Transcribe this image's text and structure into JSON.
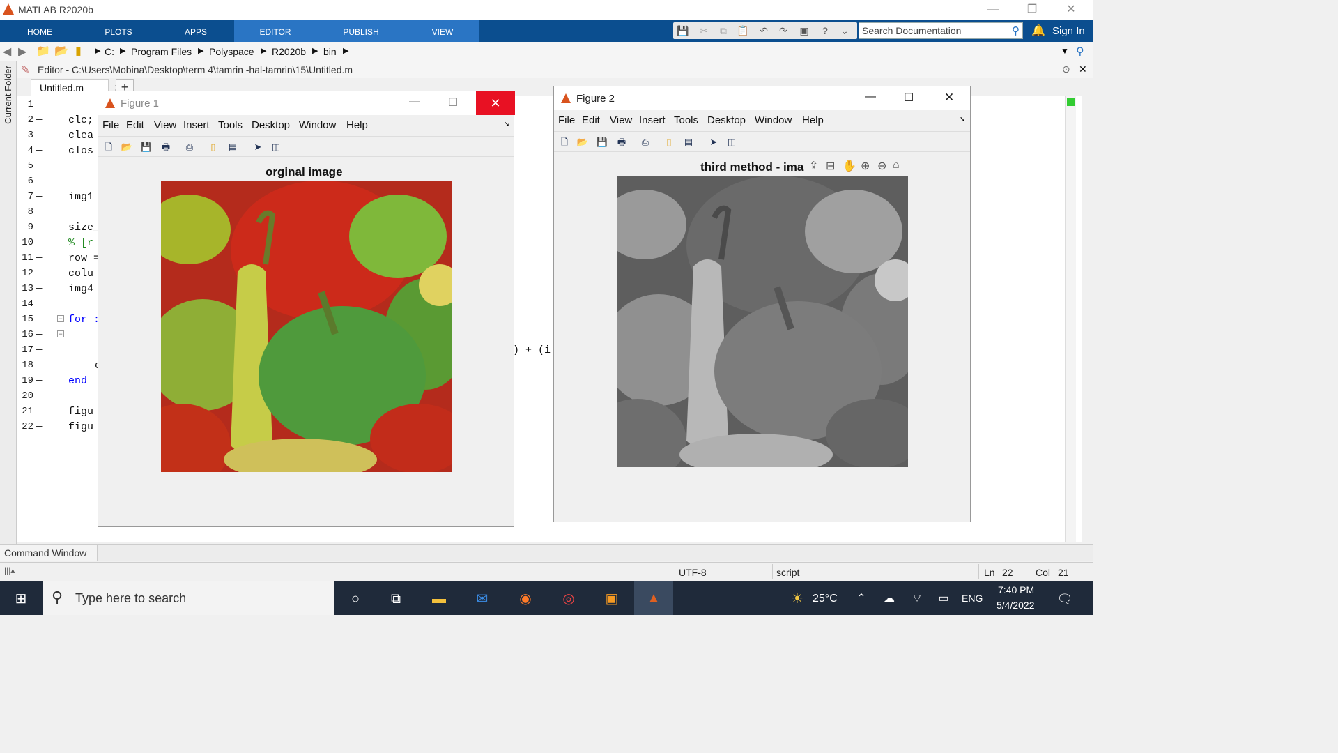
{
  "app": {
    "title": "MATLAB R2020b"
  },
  "ribbon": {
    "tabs": [
      "HOME",
      "PLOTS",
      "APPS",
      "EDITOR",
      "PUBLISH",
      "VIEW"
    ],
    "active_tab": "EDITOR",
    "search_placeholder": "Search Documentation",
    "sign_in": "Sign In"
  },
  "address": {
    "crumbs": [
      "C:",
      "Program Files",
      "Polyspace",
      "R2020b",
      "bin"
    ]
  },
  "editor": {
    "header": "Editor - C:\\Users\\Mobina\\Desktop\\term 4\\tamrin -hal-tamrin\\15\\Untitled.m",
    "file_tab": "Untitled.m",
    "add_tab": "+",
    "current_folder_label": "Current Folder",
    "lines": [
      {
        "n": "1",
        "dash": false,
        "text": ""
      },
      {
        "n": "2",
        "dash": true,
        "text": "clc;"
      },
      {
        "n": "3",
        "dash": true,
        "text": "clea"
      },
      {
        "n": "4",
        "dash": true,
        "text": "clos"
      },
      {
        "n": "5",
        "dash": false,
        "text": ""
      },
      {
        "n": "6",
        "dash": false,
        "text": ""
      },
      {
        "n": "7",
        "dash": true,
        "text": "img1"
      },
      {
        "n": "8",
        "dash": false,
        "text": ""
      },
      {
        "n": "9",
        "dash": true,
        "text": "size_"
      },
      {
        "n": "10",
        "dash": false,
        "text": "% [r",
        "comment": true
      },
      {
        "n": "11",
        "dash": true,
        "text": "row ="
      },
      {
        "n": "12",
        "dash": true,
        "text": "colu"
      },
      {
        "n": "13",
        "dash": true,
        "text": "img4"
      },
      {
        "n": "14",
        "dash": false,
        "text": ""
      },
      {
        "n": "15",
        "dash": true,
        "text": "for :",
        "keyword": true
      },
      {
        "n": "16",
        "dash": true,
        "text": ""
      },
      {
        "n": "17",
        "dash": true,
        "text": ""
      },
      {
        "n": "18",
        "dash": true,
        "text": "e"
      },
      {
        "n": "19",
        "dash": true,
        "text": "end",
        "keyword": true
      },
      {
        "n": "20",
        "dash": false,
        "text": ""
      },
      {
        "n": "21",
        "dash": true,
        "text": "figu"
      },
      {
        "n": "22",
        "dash": true,
        "text": "figu"
      }
    ],
    "fragment_line17": ") + (i"
  },
  "command_window": {
    "label": "Command Window"
  },
  "status": {
    "encoding": "UTF-8",
    "type": "script",
    "ln_label": "Ln",
    "ln": "22",
    "col_label": "Col",
    "col": "21"
  },
  "figure1": {
    "title": "Figure 1",
    "menu": [
      "File",
      "Edit",
      "View",
      "Insert",
      "Tools",
      "Desktop",
      "Window",
      "Help"
    ],
    "axes_title": "orginal image"
  },
  "figure2": {
    "title": "Figure 2",
    "menu": [
      "File",
      "Edit",
      "View",
      "Insert",
      "Tools",
      "Desktop",
      "Window",
      "Help"
    ],
    "axes_title": "third method - ima"
  },
  "taskbar": {
    "search_placeholder": "Type here to search",
    "weather": "25°C",
    "language": "ENG",
    "time": "7:40 PM",
    "date": "5/4/2022"
  },
  "colors": {
    "ribbon": "#0b4e8f",
    "ribbon_active": "#2a75c4",
    "close_red": "#e81123",
    "taskbar": "#1f2a3a"
  }
}
